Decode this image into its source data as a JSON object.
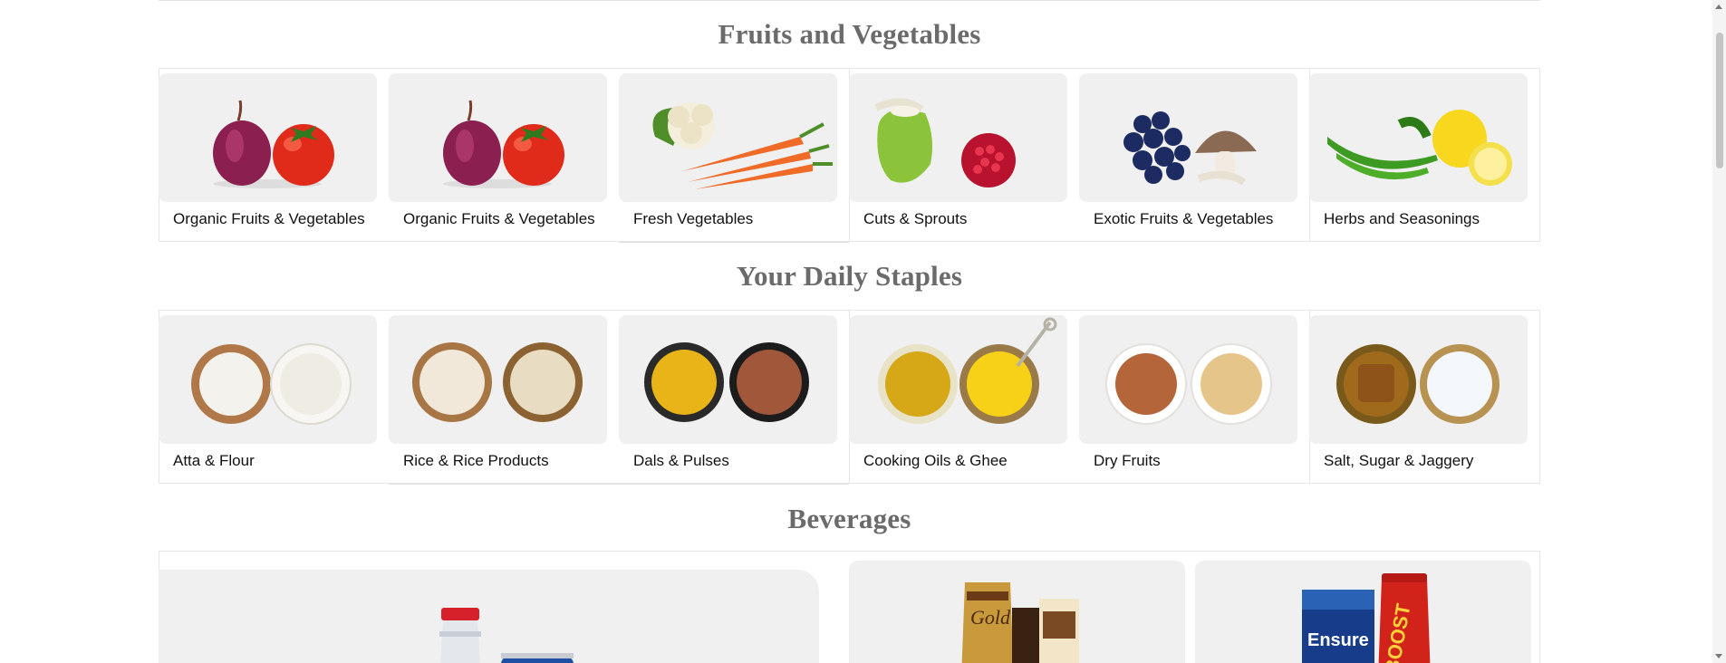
{
  "sections": {
    "fruits": {
      "title": "Fruits and Vegetables",
      "items": [
        {
          "label": "Organic Fruits & Vegetables",
          "icon": "onion-tomato-icon"
        },
        {
          "label": "Organic Fruits & Vegetables",
          "icon": "onion-tomato-icon"
        },
        {
          "label": "Fresh Vegetables",
          "icon": "cauliflower-carrot-icon"
        },
        {
          "label": "Cuts & Sprouts",
          "icon": "coconut-pomegranate-icon"
        },
        {
          "label": "Exotic Fruits & Vegetables",
          "icon": "blueberry-mushroom-icon"
        },
        {
          "label": "Herbs and Seasonings",
          "icon": "chili-lemon-icon"
        }
      ]
    },
    "staples": {
      "title": "Your Daily Staples",
      "items": [
        {
          "label": "Atta & Flour",
          "icon": "flour-bowls-icon"
        },
        {
          "label": "Rice & Rice Products",
          "icon": "rice-bowls-icon"
        },
        {
          "label": "Dals & Pulses",
          "icon": "dal-bowls-icon"
        },
        {
          "label": "Cooking Oils & Ghee",
          "icon": "oil-ghee-icon"
        },
        {
          "label": "Dry Fruits",
          "icon": "almond-cashew-icon"
        },
        {
          "label": "Salt, Sugar & Jaggery",
          "icon": "jaggery-salt-icon"
        }
      ]
    },
    "beverages": {
      "title": "Beverages",
      "tiles": [
        {
          "icon": "soda-bottle-icon"
        },
        {
          "icon": "tea-coffee-pack-icon"
        },
        {
          "icon": "health-drink-jar-icon"
        }
      ],
      "brand_text": {
        "gold": "Gold",
        "ensure": "Ensure",
        "boost": "BOOST"
      }
    }
  },
  "colors": {
    "title": "#6b6b6b",
    "tile_bg": "#f0f0f0",
    "border": "#e6e6e6"
  }
}
